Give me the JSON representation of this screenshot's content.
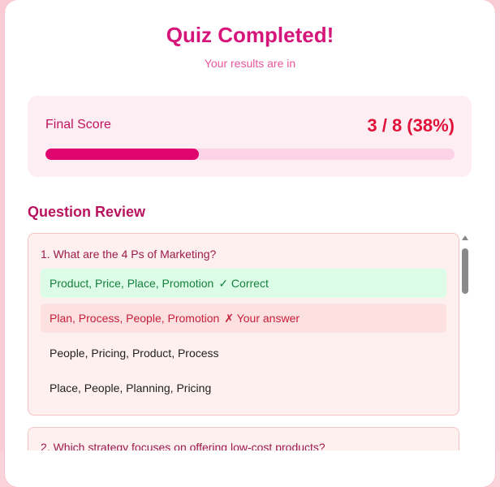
{
  "header": {
    "title": "Quiz Completed!",
    "subtitle": "Your results are in"
  },
  "score": {
    "label": "Final Score",
    "value_text": "3 / 8 (38%)",
    "correct": 3,
    "total": 8,
    "percent": 38
  },
  "review": {
    "heading": "Question Review",
    "questions": [
      {
        "text": "1. What are the 4 Ps of Marketing?",
        "options": [
          {
            "label": "Product, Price, Place, Promotion",
            "tag": "✓ Correct",
            "state": "correct"
          },
          {
            "label": "Plan, Process, People, Promotion",
            "tag": "✗ Your answer",
            "state": "wrong"
          },
          {
            "label": "People, Pricing, Product, Process",
            "tag": "",
            "state": "neutral"
          },
          {
            "label": "Place, People, Planning, Pricing",
            "tag": "",
            "state": "neutral"
          }
        ]
      },
      {
        "text": "2. Which strategy focuses on offering low-cost products?",
        "options": []
      }
    ]
  },
  "colors": {
    "accent": "#d6157a",
    "score": "#e0123a",
    "progress_fill": "#e0066f",
    "correct_bg": "#dcfce7",
    "wrong_bg": "#fde0e0"
  }
}
